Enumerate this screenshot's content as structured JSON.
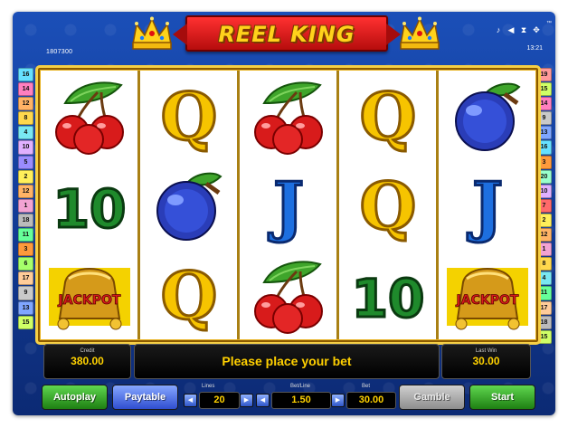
{
  "header": {
    "title": "REEL KING",
    "trademark": "™",
    "reference": "1807300",
    "clock": "13:21",
    "icons": [
      "music-icon",
      "sound-icon",
      "hourglass-icon",
      "fullscreen-icon"
    ]
  },
  "reels": [
    [
      "cherry",
      "10",
      "jackpot"
    ],
    [
      "Q",
      "plum",
      "Q"
    ],
    [
      "cherry",
      "J",
      "cherry"
    ],
    [
      "Q",
      "Q",
      "10"
    ],
    [
      "plum",
      "J",
      "jackpot"
    ]
  ],
  "symbols": {
    "jackpot_text": "JACKPOT",
    "ten": "10",
    "queen": "Q",
    "jack": "J"
  },
  "line_markers_left": [
    "16",
    "14",
    "12",
    "8",
    "4",
    "10",
    "5",
    "2",
    "12",
    "1",
    "18",
    "11",
    "3",
    "6",
    "17",
    "9",
    "13",
    "15"
  ],
  "line_markers_right": [
    "19",
    "15",
    "14",
    "9",
    "13",
    "16",
    "3",
    "20",
    "10",
    "7",
    "2",
    "12",
    "1",
    "8",
    "4",
    "11",
    "17",
    "18",
    "15"
  ],
  "line_colors": [
    "#f2a3d3",
    "#ffef5a",
    "#ff9a3c",
    "#79e7f2",
    "#9a8cff",
    "#a6ff6b",
    "#ff6a6a",
    "#ffd84d",
    "#c9c9c9",
    "#e0b0ff",
    "#66ff99",
    "#ffb366",
    "#7fa6ff",
    "#ff7fbf",
    "#cfff66",
    "#66e0ff",
    "#ffcc99",
    "#bbbbbb",
    "#ff9999",
    "#99ffcc"
  ],
  "credit": {
    "label": "Credit",
    "value": "380.00"
  },
  "message": "Please place your bet",
  "last_win": {
    "label": "Last Win",
    "value": "30.00"
  },
  "buttons": {
    "autoplay": "Autoplay",
    "paytable": "Paytable",
    "gamble": "Gamble",
    "start": "Start"
  },
  "lines": {
    "label": "Lines",
    "value": "20"
  },
  "bet_line": {
    "label": "Bet/Line",
    "value": "1.50"
  },
  "bet": {
    "label": "Bet",
    "value": "30.00"
  },
  "colors": {
    "frame": "#1b4fb8",
    "reel_border": "#f6cf45",
    "display_text": "#ffd200",
    "button_green": "#1e8012",
    "button_blue": "#2f4ed0",
    "button_disabled": "#8e8e8e"
  }
}
